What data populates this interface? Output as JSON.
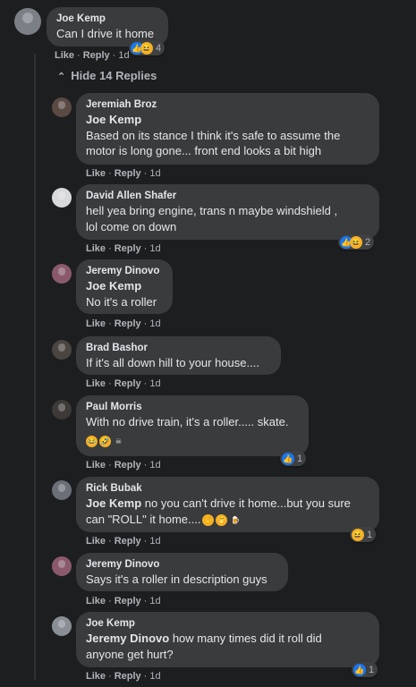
{
  "top_comment": {
    "author": "Joe Kemp",
    "text": "Can I drive it home",
    "like": "Like",
    "reply": "Reply",
    "time": "1d",
    "reaction_count": "4"
  },
  "hide_replies": "Hide 14 Replies",
  "replies": [
    {
      "author": "Jeremiah Broz",
      "mention": "Joe Kemp",
      "text_line1": "Based on its stance I think it's safe to assume the",
      "text_line2": "motor is long gone... front end looks a bit high",
      "like": "Like",
      "reply": "Reply",
      "time": "1d"
    },
    {
      "author": "David Allen Shafer",
      "text_line1": "hell yea bring engine, trans n maybe windshield ,",
      "text_line2": "lol come on down",
      "like": "Like",
      "reply": "Reply",
      "time": "1d",
      "reaction_count": "2"
    },
    {
      "author": "Jeremy Dinovo",
      "mention": "Joe Kemp",
      "text_line1": "No it's a roller",
      "like": "Like",
      "reply": "Reply",
      "time": "1d"
    },
    {
      "author": "Brad Bashor",
      "text_line1": "If it's all down hill to your house....",
      "like": "Like",
      "reply": "Reply",
      "time": "1d"
    },
    {
      "author": "Paul Morris",
      "text_line1": "With no drive train, it's a roller..... skate.",
      "like": "Like",
      "reply": "Reply",
      "time": "1d",
      "reaction_count": "1"
    },
    {
      "author": "Rick Bubak",
      "mention": "Joe Kemp",
      "text_line1": "no you can't drive it home...but you sure",
      "text_line2": "can \"ROLL\" it home....",
      "like": "Like",
      "reply": "Reply",
      "time": "1d",
      "reaction_count": "1"
    },
    {
      "author": "Jeremy Dinovo",
      "text_line1": "Says it's a roller in description guys",
      "like": "Like",
      "reply": "Reply",
      "time": "1d"
    },
    {
      "author": "Joe Kemp",
      "mention": "Jeremy Dinovo",
      "text_line1": "how many times did it roll did",
      "text_line2": "anyone get hurt?",
      "like": "Like",
      "reply": "Reply",
      "time": "1d",
      "reaction_count": "1"
    }
  ],
  "icons": {
    "like": "like-reaction-icon",
    "haha": "haha-reaction-icon",
    "avatar": "profile-avatar"
  },
  "colors": {
    "background": "#1d1e20",
    "bubble": "#3a3b3c",
    "like_blue": "#1877f2",
    "haha_yellow": "#f7b125"
  }
}
